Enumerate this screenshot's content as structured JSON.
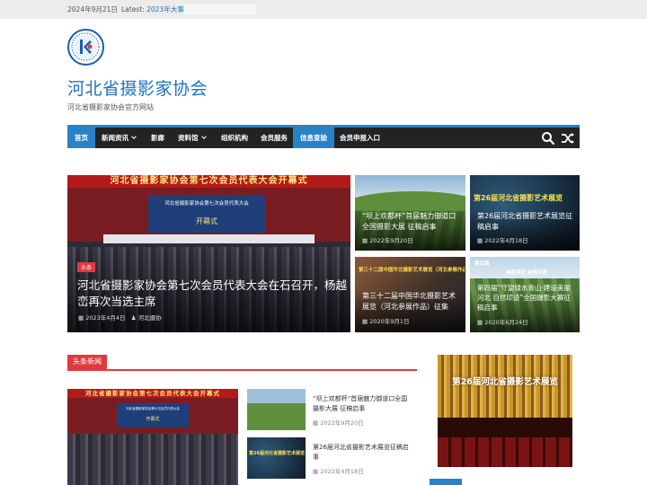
{
  "topbar": {
    "date": "2024年9月21日",
    "latest_label": "Latest:",
    "latest_link": "2023年大事记"
  },
  "site": {
    "title": "河北省摄影家协会",
    "tagline": "河北省摄影家协会官方网站",
    "logo_icon": "hebei-photographers-logo"
  },
  "colors": {
    "accent": "#2a82c6",
    "nav_bg": "#232323",
    "title_blue": "#1e73be",
    "tag_red": "#e03a3e"
  },
  "nav": {
    "items": [
      {
        "label": "首页",
        "active": true
      },
      {
        "label": "新闻资讯",
        "dropdown": true
      },
      {
        "label": "影廊"
      },
      {
        "label": "资料馆",
        "dropdown": true
      },
      {
        "label": "组织机构"
      },
      {
        "label": "会员服务"
      },
      {
        "label": "信息查验",
        "active": true
      },
      {
        "label": "会员申报入口"
      }
    ],
    "search_icon": "search-icon",
    "random_icon": "shuffle-icon"
  },
  "featured": {
    "main": {
      "banner": "河北省摄影家协会第七次会员代表大会开幕式",
      "screen_title": "河北省摄影家协会第七次会员代表大会",
      "screen_sub": "开幕式",
      "tag": "头条",
      "title": "河北省摄影家协会第七次会员代表大会在石召开，杨越峦再次当选主席",
      "date": "2023年4月4日",
      "author": "河北摄协"
    },
    "cards": [
      {
        "title": "“坝上欢都杯”首届魅力御道口全国摄影大展 征稿启事",
        "date": "2022年9月20日"
      },
      {
        "overlay": "第26届河北省摄影艺术展览",
        "title": "第26届河北省摄影艺术展览征稿启事",
        "date": "2022年4月18日"
      },
      {
        "overlay": "第三十二届中国华北摄影艺术展览（河北参展作品）征集",
        "title": "第三十二届中国华北摄影艺术展览（河北参展作品）征集",
        "date": "2020年9月1日"
      },
      {
        "overlay_top": "第四届",
        "overlay_mid": "美丽河北 自然印迹",
        "title": "第四届“守望绿水青山·建设美丽河北 自然印迹”全国摄影大赛征稿启事",
        "date": "2020年6月24日"
      }
    ]
  },
  "section": {
    "title": "头条新闻"
  },
  "headlines": [
    {
      "title": "“坝上欢都杯”首届魅力御道口全国摄影大展 征稿启事",
      "date": "2022年9月20日"
    },
    {
      "title": "第26届河北省摄影艺术展览征稿启事",
      "date": "2022年4月18日"
    }
  ],
  "headline_thumb": {
    "banner": "河北省摄影家协会第七次会员代表大会开幕式",
    "screen_title": "河北省摄影家协会第七次会员代表大会",
    "screen_sub": "开幕式"
  },
  "ad": {
    "text": "第26届河北省摄影艺术展览"
  }
}
